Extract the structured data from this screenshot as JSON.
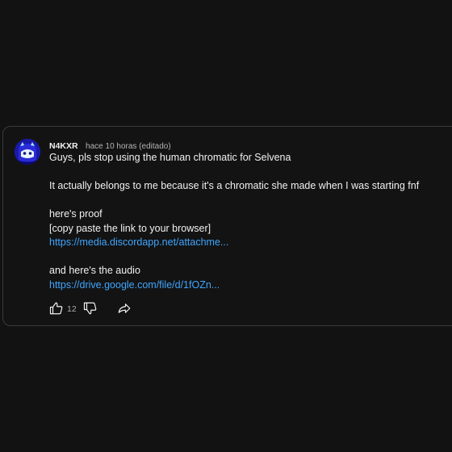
{
  "comment": {
    "author": "N4KXR",
    "timestamp": "hace 10 horas (editado)",
    "lines": {
      "l1": "Guys, pls stop using the human chromatic for Selvena",
      "l2": "It actually belongs to me because it's a chromatic she made when I was starting fnf",
      "l3": "here's proof",
      "l4": "[copy paste the link to your browser]",
      "link1": "https://media.discordapp.net/attachme...",
      "l5": "and here's the audio",
      "link2": "https://drive.google.com/file/d/1fOZn..."
    },
    "like_count": "12"
  },
  "icons": {
    "avatar": "avatar-icon",
    "like": "thumbs-up-icon",
    "dislike": "thumbs-down-icon",
    "share": "share-icon"
  },
  "colors": {
    "background": "#121212",
    "text": "#f1f1f1",
    "muted": "#aaaaaa",
    "link": "#3ea6ff",
    "avatar": "#1a1aa8"
  }
}
